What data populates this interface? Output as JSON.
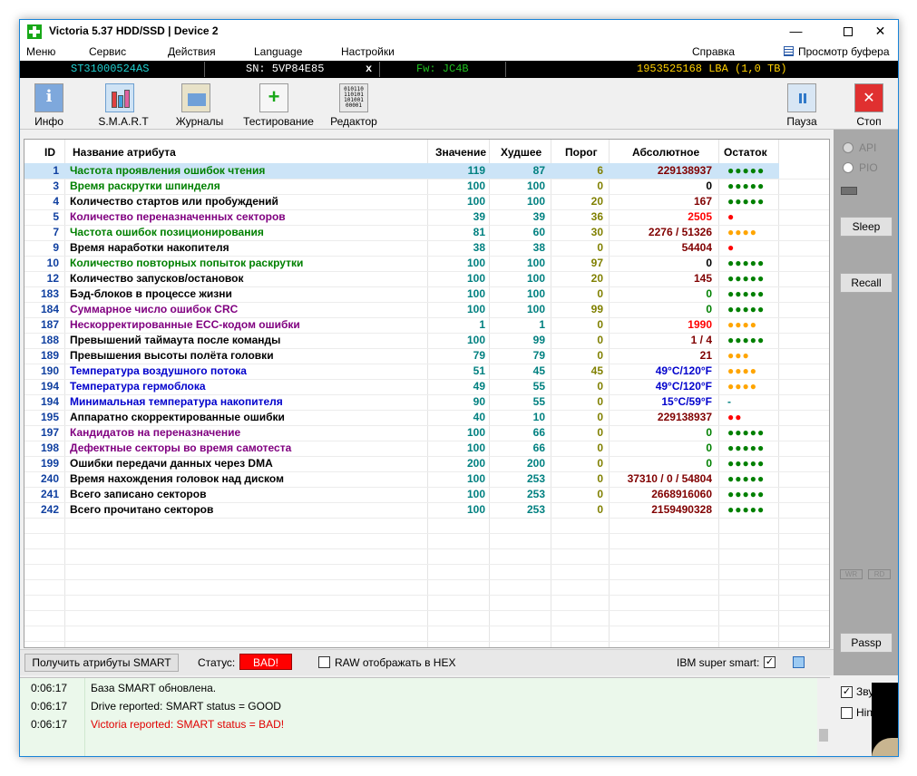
{
  "window": {
    "title": "Victoria 5.37 HDD/SSD | Device 2",
    "minimize_glyph": "—",
    "close_glyph": "✕"
  },
  "menu": {
    "items": [
      "Меню",
      "Сервис",
      "Действия",
      "Language",
      "Настройки"
    ],
    "help": "Справка",
    "buffer": "Просмотр буфера"
  },
  "device": {
    "model": "ST31000524AS",
    "serial": "SN: 5VP84E85",
    "close_glyph": "x",
    "firmware": "Fw: JC4B",
    "capacity": "1953525168 LBA (1,0 TB)"
  },
  "toolbar": {
    "info": "Инфо",
    "smart": "S.M.A.R.T",
    "journals": "Журналы",
    "testing": "Тестирование",
    "editor": "Редактор",
    "editor_icon_text": "01011011010110100100001",
    "pause": "Пауза",
    "stop": "Стоп"
  },
  "table": {
    "headers": {
      "id": "ID",
      "name": "Название атрибута",
      "value": "Значение",
      "worst": "Худшее",
      "threshold": "Порог",
      "raw": "Абсолютное",
      "health": "Остаток"
    },
    "rows": [
      {
        "id": "1",
        "name": "Частота проявления ошибок чтения",
        "value": "119",
        "worst": "87",
        "threshold": "6",
        "raw": "229138937",
        "health": "●●●●●"
      },
      {
        "id": "3",
        "name": "Время раскрутки шпинделя",
        "value": "100",
        "worst": "100",
        "threshold": "0",
        "raw": "0",
        "health": "●●●●●"
      },
      {
        "id": "4",
        "name": "Количество стартов или пробуждений",
        "value": "100",
        "worst": "100",
        "threshold": "20",
        "raw": "167",
        "health": "●●●●●"
      },
      {
        "id": "5",
        "name": "Количество переназначенных секторов",
        "value": "39",
        "worst": "39",
        "threshold": "36",
        "raw": "2505",
        "health": "●"
      },
      {
        "id": "7",
        "name": "Частота ошибок позиционирования",
        "value": "81",
        "worst": "60",
        "threshold": "30",
        "raw": "2276 / 51326",
        "health": "●●●●"
      },
      {
        "id": "9",
        "name": "Время наработки накопителя",
        "value": "38",
        "worst": "38",
        "threshold": "0",
        "raw": "54404",
        "health": "●"
      },
      {
        "id": "10",
        "name": "Количество повторных попыток раскрутки",
        "value": "100",
        "worst": "100",
        "threshold": "97",
        "raw": "0",
        "health": "●●●●●"
      },
      {
        "id": "12",
        "name": "Количество запусков/остановок",
        "value": "100",
        "worst": "100",
        "threshold": "20",
        "raw": "145",
        "health": "●●●●●"
      },
      {
        "id": "183",
        "name": "Бэд-блоков в процессе жизни",
        "value": "100",
        "worst": "100",
        "threshold": "0",
        "raw": "0",
        "health": "●●●●●"
      },
      {
        "id": "184",
        "name": "Суммарное число ошибок CRC",
        "value": "100",
        "worst": "100",
        "threshold": "99",
        "raw": "0",
        "health": "●●●●●"
      },
      {
        "id": "187",
        "name": "Нескорректированные ECC-кодом ошибки",
        "value": "1",
        "worst": "1",
        "threshold": "0",
        "raw": "1990",
        "health": "●●●●"
      },
      {
        "id": "188",
        "name": "Превышений таймаута после команды",
        "value": "100",
        "worst": "99",
        "threshold": "0",
        "raw": "1 / 4",
        "health": "●●●●●"
      },
      {
        "id": "189",
        "name": "Превышения высоты полёта головки",
        "value": "79",
        "worst": "79",
        "threshold": "0",
        "raw": "21",
        "health": "●●●"
      },
      {
        "id": "190",
        "name": "Температура воздушного потока",
        "value": "51",
        "worst": "45",
        "threshold": "45",
        "raw": "49°C/120°F",
        "health": "●●●●"
      },
      {
        "id": "194",
        "name": "Температура гермоблока",
        "value": "49",
        "worst": "55",
        "threshold": "0",
        "raw": "49°C/120°F",
        "health": "●●●●"
      },
      {
        "id": "194",
        "name": "Минимальная температура накопителя",
        "value": "90",
        "worst": "55",
        "threshold": "0",
        "raw": "15°C/59°F",
        "health": "-"
      },
      {
        "id": "195",
        "name": "Аппаратно скорректированные ошибки",
        "value": "40",
        "worst": "10",
        "threshold": "0",
        "raw": "229138937",
        "health": "●●"
      },
      {
        "id": "197",
        "name": "Кандидатов на переназначение",
        "value": "100",
        "worst": "66",
        "threshold": "0",
        "raw": "0",
        "health": "●●●●●"
      },
      {
        "id": "198",
        "name": "Дефектные секторы во время самотеста",
        "value": "100",
        "worst": "66",
        "threshold": "0",
        "raw": "0",
        "health": "●●●●●"
      },
      {
        "id": "199",
        "name": "Ошибки передачи данных через DMA",
        "value": "200",
        "worst": "200",
        "threshold": "0",
        "raw": "0",
        "health": "●●●●●"
      },
      {
        "id": "240",
        "name": "Время нахождения головок над диском",
        "value": "100",
        "worst": "253",
        "threshold": "0",
        "raw": "37310 / 0 / 54804",
        "health": "●●●●●"
      },
      {
        "id": "241",
        "name": "Всего записано секторов",
        "value": "100",
        "worst": "253",
        "threshold": "0",
        "raw": "2668916060",
        "health": "●●●●●"
      },
      {
        "id": "242",
        "name": "Всего прочитано секторов",
        "value": "100",
        "worst": "253",
        "threshold": "0",
        "raw": "2159490328",
        "health": "●●●●●"
      }
    ]
  },
  "colors": {
    "name_colors": [
      "#008000",
      "#008000",
      "#000000",
      "#800080",
      "#008000",
      "#000000",
      "#008000",
      "#000000",
      "#000000",
      "#800080",
      "#800080",
      "#000000",
      "#000000",
      "#0000cc",
      "#0000cc",
      "#0000cc",
      "#000000",
      "#800080",
      "#800080",
      "#000000",
      "#000000",
      "#000000",
      "#000000"
    ],
    "raw_colors": [
      "#800000",
      "#000000",
      "#800000",
      "#ff0000",
      "#800000",
      "#800000",
      "#000000",
      "#800000",
      "#008000",
      "#008000",
      "#ff0000",
      "#800000",
      "#800000",
      "#0000cc",
      "#0000cc",
      "#0000cc",
      "#800000",
      "#008000",
      "#008000",
      "#008000",
      "#800000",
      "#800000",
      "#800000"
    ],
    "health_colors": [
      "#008000",
      "#008000",
      "#008000",
      "#ff0000",
      "#ffa500",
      "#ff0000",
      "#008000",
      "#008000",
      "#008000",
      "#008000",
      "#ffa500",
      "#008000",
      "#ffa500",
      "#ffa500",
      "#ffa500",
      "#008080",
      "#ff0000",
      "#008000",
      "#008000",
      "#008000",
      "#008000",
      "#008000",
      "#008000"
    ],
    "status_bad": "#ff0000"
  },
  "side": {
    "api": "API",
    "pio": "PIO",
    "sleep": "Sleep",
    "recall": "Recall",
    "wr": "WR",
    "rd": "RD",
    "passp": "Passp",
    "sound_label": "Звук",
    "hints_label": "Hints",
    "check_glyph": "✓"
  },
  "status": {
    "get_button": "Получить атрибуты SMART",
    "label": "Статус:",
    "value": "BAD!",
    "raw_hex_label": "RAW отображать в HEX",
    "ibm_label": "IBM super smart:"
  },
  "log": [
    {
      "time": "0:06:17",
      "message": "База SMART обновлена.",
      "color": "#000000"
    },
    {
      "time": "0:06:17",
      "message": "Drive reported: SMART status = GOOD",
      "color": "#000000"
    },
    {
      "time": "0:06:17",
      "message": "Victoria reported: SMART status = BAD!",
      "color": "#e00000"
    }
  ]
}
